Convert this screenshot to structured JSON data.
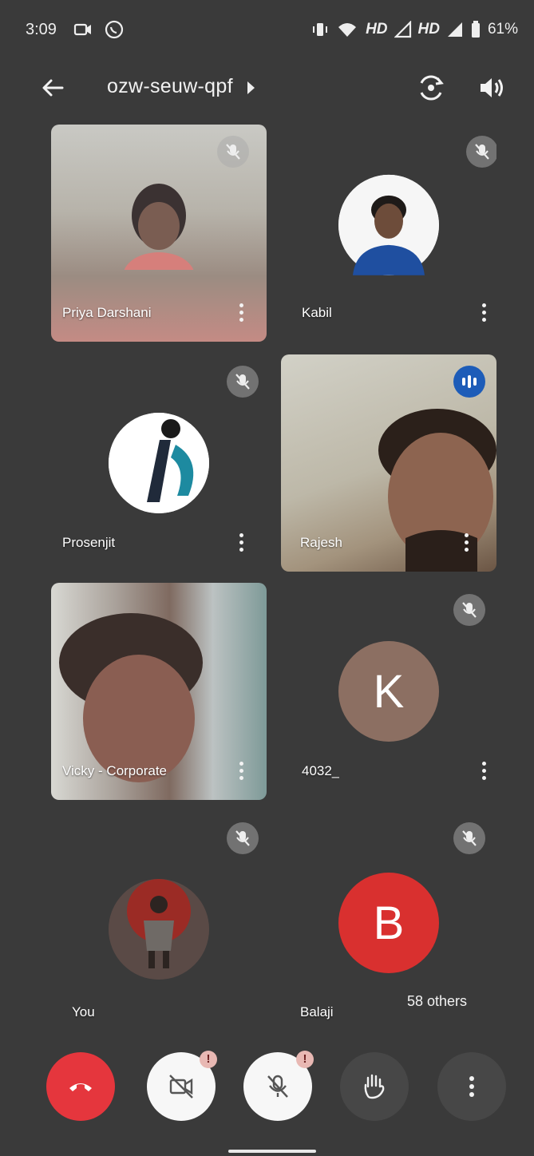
{
  "status": {
    "time": "3:09",
    "net1": "HD",
    "net2": "HD",
    "battery": "61%"
  },
  "header": {
    "meeting_code": "ozw-seuw-qpf"
  },
  "participants": [
    {
      "name": "Priya Darshani",
      "muted": true,
      "video": true
    },
    {
      "name": "Kabil",
      "muted": true,
      "video": false
    },
    {
      "name": "Prosenjit",
      "muted": true,
      "video": false
    },
    {
      "name": "Rajesh",
      "muted": false,
      "speaking": true,
      "video": true
    },
    {
      "name": "Vicky - Corporate",
      "muted": false,
      "video": true
    },
    {
      "name": "4032_",
      "muted": true,
      "video": false,
      "initial": "K",
      "avatar_color": "#8c6f62"
    },
    {
      "name": "You",
      "muted": true,
      "video": false
    },
    {
      "name": "Balaji",
      "muted": true,
      "video": false,
      "initial": "B",
      "avatar_color": "#d9302f"
    }
  ],
  "others_label": "58 others",
  "controls": {
    "warn_glyph": "!"
  },
  "colors": {
    "background": "#3a3a3a",
    "end_call": "#e5363d",
    "speaking": "#1d5cb8"
  }
}
